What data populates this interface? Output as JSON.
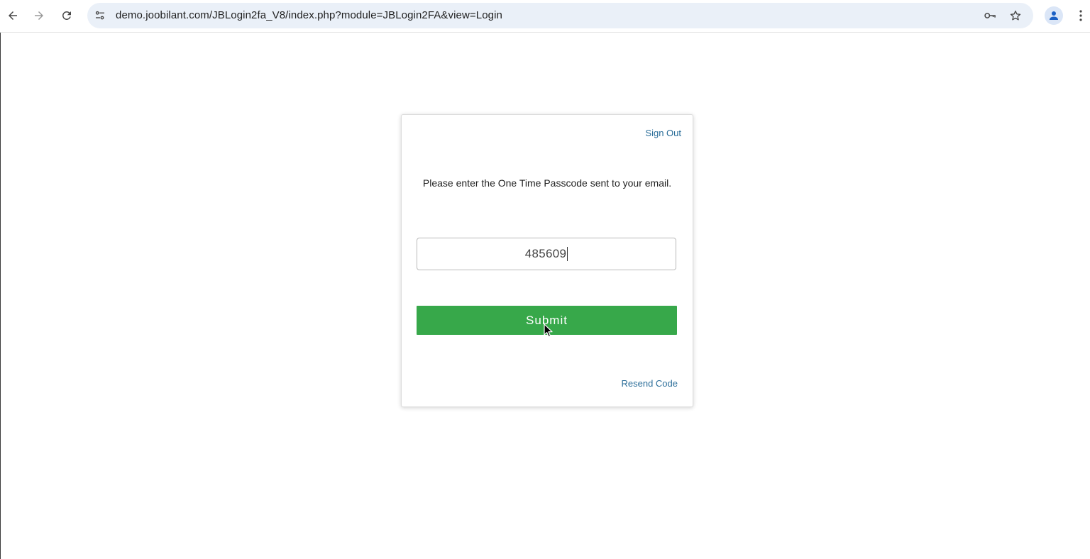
{
  "browser": {
    "url": "demo.joobilant.com/JBLogin2fa_V8/index.php?module=JBLogin2FA&view=Login",
    "icons": {
      "back": "arrow-left-icon",
      "forward": "arrow-right-icon",
      "reload": "reload-icon",
      "site_info": "tune-icon",
      "password": "key-icon",
      "bookmark": "star-icon",
      "profile": "person-icon",
      "menu": "kebab-menu-icon"
    }
  },
  "card": {
    "sign_out_label": "Sign Out",
    "instruction": "Please enter the One Time Passcode sent to your email.",
    "otp_value": "485609",
    "submit_label": "Submit",
    "resend_label": "Resend Code"
  },
  "colors": {
    "accent_green": "#37a84a",
    "link_blue": "#2a6d99",
    "omnibox_bg": "#eaf0f8"
  }
}
